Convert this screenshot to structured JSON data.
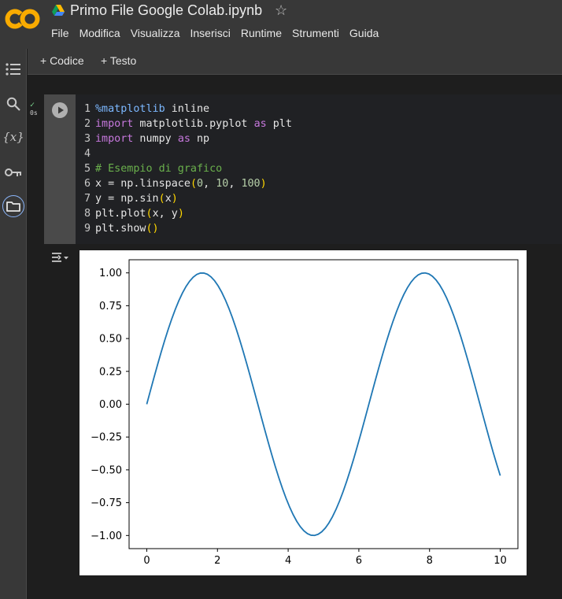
{
  "header": {
    "logo_text": "CO",
    "title": "Primo File Google Colab.ipynb",
    "star_icon": "star-outline-icon",
    "brand_colors": {
      "logo_orange": "#f9ab00",
      "logo_orange_dark": "#e8710a"
    }
  },
  "menu": {
    "items": [
      "File",
      "Modifica",
      "Visualizza",
      "Inserisci",
      "Runtime",
      "Strumenti",
      "Guida"
    ]
  },
  "sidebar": {
    "icons": [
      "table-of-contents-icon",
      "search-icon",
      "variables-icon",
      "key-icon",
      "folder-icon"
    ],
    "variables_glyph": "{x}",
    "active": "folder-icon"
  },
  "toolbar": {
    "add_code_label": "+ Codice",
    "add_text_label": "+ Testo"
  },
  "cell": {
    "status_check": "✓",
    "exec_time": "0s",
    "lines": [
      {
        "no": "1",
        "tokens": [
          [
            "mg",
            "%matplotlib"
          ],
          [
            "tx",
            " inline"
          ]
        ]
      },
      {
        "no": "2",
        "tokens": [
          [
            "kw",
            "import"
          ],
          [
            "tx",
            " matplotlib.pyplot "
          ],
          [
            "kw",
            "as"
          ],
          [
            "tx",
            " plt"
          ]
        ]
      },
      {
        "no": "3",
        "tokens": [
          [
            "kw",
            "import"
          ],
          [
            "tx",
            " numpy "
          ],
          [
            "kw",
            "as"
          ],
          [
            "tx",
            " np"
          ]
        ]
      },
      {
        "no": "4",
        "tokens": []
      },
      {
        "no": "5",
        "tokens": [
          [
            "cm",
            "# Esempio di grafico"
          ]
        ]
      },
      {
        "no": "6",
        "tokens": [
          [
            "tx",
            "x = np.linspace"
          ],
          [
            "pr",
            "("
          ],
          [
            "nm",
            "0"
          ],
          [
            "tx",
            ", "
          ],
          [
            "nm",
            "10"
          ],
          [
            "tx",
            ", "
          ],
          [
            "nm",
            "100"
          ],
          [
            "pr",
            ")"
          ]
        ]
      },
      {
        "no": "7",
        "tokens": [
          [
            "tx",
            "y = np.sin"
          ],
          [
            "pr",
            "("
          ],
          [
            "tx",
            "x"
          ],
          [
            "pr",
            ")"
          ]
        ]
      },
      {
        "no": "8",
        "tokens": [
          [
            "tx",
            "plt.plot"
          ],
          [
            "pr",
            "("
          ],
          [
            "tx",
            "x, y"
          ],
          [
            "pr",
            ")"
          ]
        ]
      },
      {
        "no": "9",
        "tokens": [
          [
            "tx",
            "plt.show"
          ],
          [
            "pr",
            "()"
          ]
        ]
      }
    ]
  },
  "chart_data": {
    "type": "line",
    "series": [
      {
        "function": "sin",
        "x_start": 0,
        "x_end": 10,
        "n_points": 100,
        "color": "#1f77b4"
      }
    ],
    "xlim": [
      -0.5,
      10.5
    ],
    "ylim": [
      -1.1,
      1.1
    ],
    "xticks": [
      0,
      2,
      4,
      6,
      8,
      10
    ],
    "xtick_labels": [
      "0",
      "2",
      "4",
      "6",
      "8",
      "10"
    ],
    "yticks": [
      1.0,
      0.75,
      0.5,
      0.25,
      0.0,
      -0.25,
      -0.5,
      -0.75,
      -1.0
    ],
    "ytick_labels": [
      "1.00",
      "0.75",
      "0.50",
      "0.25",
      "0.00",
      "−0.25",
      "−0.50",
      "−0.75",
      "−1.00"
    ],
    "grid": false,
    "title": "",
    "xlabel": "",
    "ylabel": ""
  }
}
